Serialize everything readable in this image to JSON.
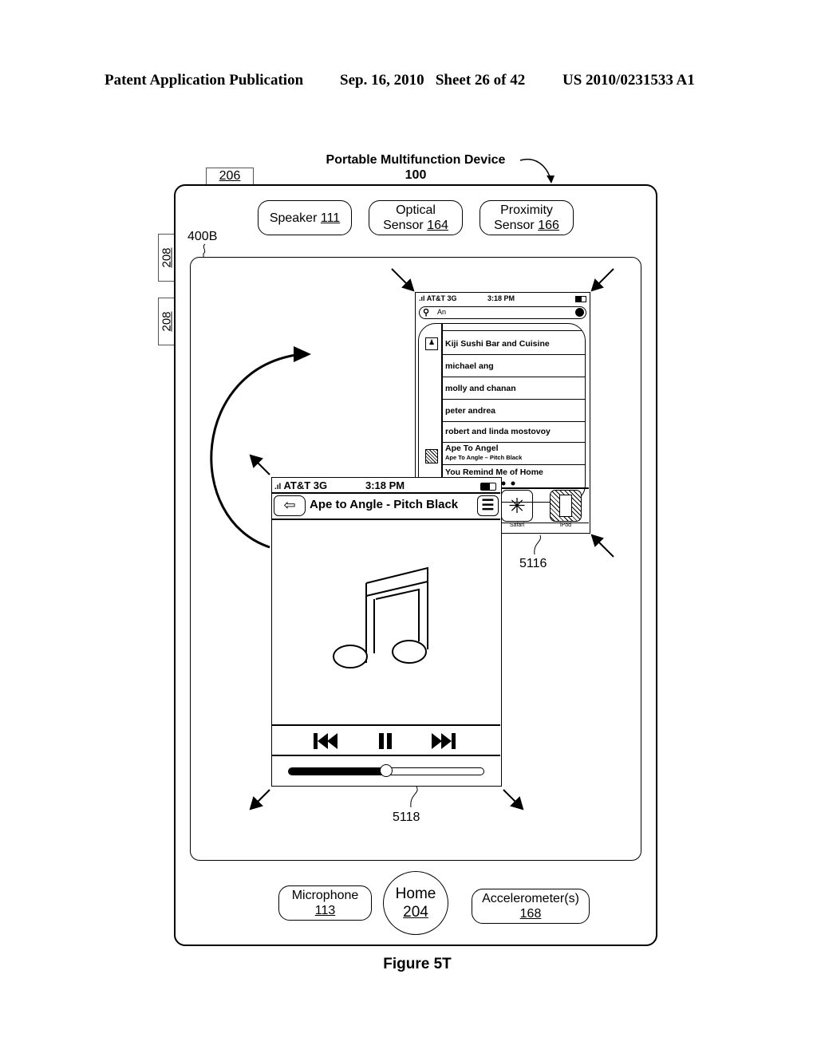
{
  "header": {
    "left": "Patent Application Publication",
    "date_sheet": "Sep. 16, 2010   Sheet 26 of 42",
    "pub_number": "US 2010/0231533 A1"
  },
  "device": {
    "title": "Portable Multifunction Device",
    "ref": "100",
    "ref_206": "206",
    "ref_208a": "208",
    "ref_208b": "208",
    "screen_ref": "400B",
    "speaker": {
      "label": "Speaker",
      "ref": "111"
    },
    "optical": {
      "label1": "Optical",
      "label2": "Sensor",
      "ref": "164"
    },
    "proximity": {
      "label1": "Proximity",
      "label2": "Sensor",
      "ref": "166"
    },
    "microphone": {
      "label": "Microphone",
      "ref": "113"
    },
    "home": {
      "label": "Home",
      "ref": "204"
    },
    "accelerometer": {
      "label": "Accelerometer(s)",
      "ref": "168"
    }
  },
  "back_phone": {
    "ref": "5116",
    "status": {
      "carrier": "AT&T 3G",
      "time": "3:18 PM"
    },
    "search_value": "An",
    "list": [
      "Kiji Sushi Bar and Cuisine",
      "michael ang",
      "molly and chanan",
      "peter andrea",
      "robert and linda mostovoy"
    ],
    "song_title": "Ape To Angel",
    "song_sub": "Ape To Angle  –  Pitch Black",
    "next_item": "You Remind Me of Home",
    "dock": [
      "Safari",
      "iPod"
    ]
  },
  "front_phone": {
    "ref": "5118",
    "status": {
      "carrier": "AT&T 3G",
      "time": "3:18 PM"
    },
    "title": "Ape to Angle - Pitch Black",
    "progress": 0.5
  },
  "caption": "Figure 5T"
}
